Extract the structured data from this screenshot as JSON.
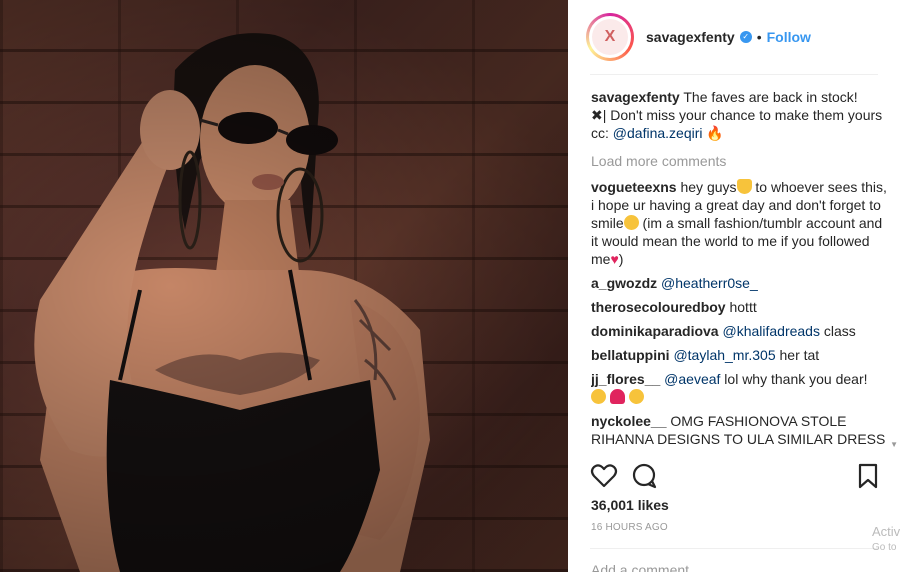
{
  "post": {
    "username": "savagexfenty",
    "follow_label": "Follow",
    "dot": "•",
    "avatar_glyph": "X",
    "caption": {
      "username": "savagexfenty",
      "line1": "The faves are back in stock!",
      "line2": "| Don't miss your chance to make them yours",
      "cc_prefix": "cc:",
      "cc_mention": "@dafina.zeqiri"
    },
    "load_more": "Load more comments",
    "comments": [
      {
        "user": "vogueteexns",
        "text_a": "hey guys",
        "text_b": " to whoever sees this, i hope ur having a great day and don't forget to smile",
        "text_c": " (im a small fashion/tumblr account and it would mean the world to me if you followed me",
        "text_d": ")"
      },
      {
        "user": "a_gwozdz",
        "mention": "@heatherr0se_"
      },
      {
        "user": "therosecolouredboy",
        "text": "hottt"
      },
      {
        "user": "dominikaparadiova",
        "mention": "@khalifadreads",
        "text": "class"
      },
      {
        "user": "bellatuppini",
        "mention": "@taylah_mr.305",
        "text": "her tat"
      },
      {
        "user": "jj_flores__",
        "mention": "@aeveaf",
        "text": "lol why thank you dear!"
      },
      {
        "user": "nyckolee__",
        "text": "OMG FASHIONOVA STOLE RIHANNA DESIGNS TO ULA SIMILAR DRESS"
      }
    ],
    "likes": "36,001 likes",
    "time": "16 HOURS AGO",
    "add_comment_placeholder": "Add a comment..."
  },
  "overlay": {
    "line1": "Activ",
    "line2": "Go to"
  },
  "icons": {
    "heart": "heart-icon",
    "comment": "comment-icon",
    "bookmark": "bookmark-icon",
    "verified": "verified-badge-icon"
  },
  "colors": {
    "link": "#3897f0",
    "mention": "#003569",
    "muted": "#999999"
  }
}
